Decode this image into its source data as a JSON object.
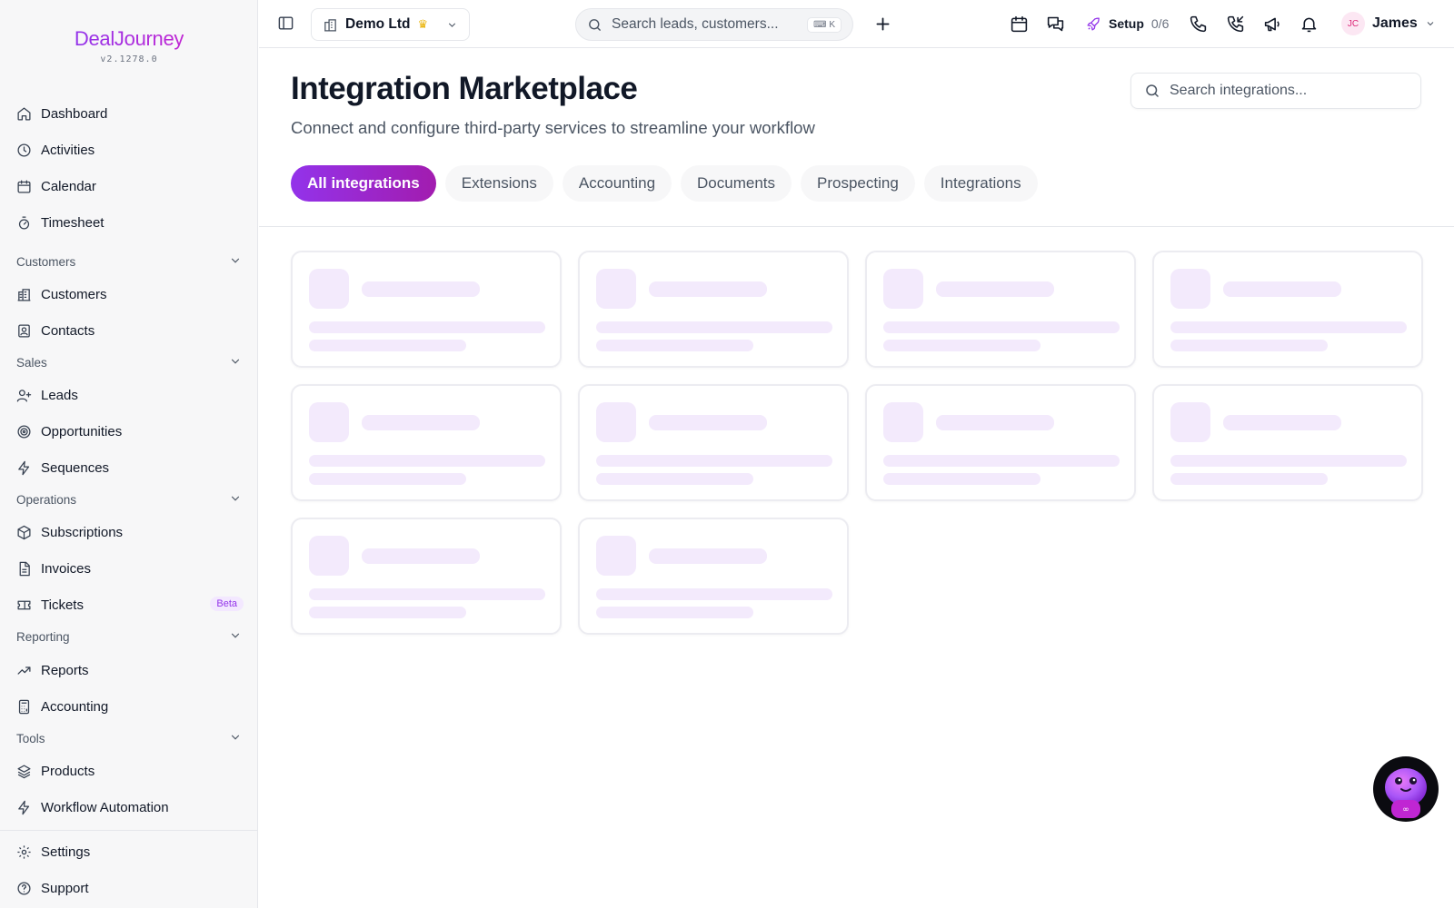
{
  "app": {
    "logo": "DealJourney",
    "version": "v2.1278.0"
  },
  "sidebar": {
    "items_top": [
      {
        "label": "Dashboard",
        "icon": "home-icon"
      },
      {
        "label": "Activities",
        "icon": "clock-icon"
      },
      {
        "label": "Calendar",
        "icon": "calendar-icon"
      },
      {
        "label": "Timesheet",
        "icon": "timer-icon"
      }
    ],
    "sections": [
      {
        "title": "Customers",
        "items": [
          {
            "label": "Customers",
            "icon": "building-icon"
          },
          {
            "label": "Contacts",
            "icon": "contact-icon"
          }
        ]
      },
      {
        "title": "Sales",
        "items": [
          {
            "label": "Leads",
            "icon": "user-plus-icon"
          },
          {
            "label": "Opportunities",
            "icon": "target-icon"
          },
          {
            "label": "Sequences",
            "icon": "zap-icon"
          }
        ]
      },
      {
        "title": "Operations",
        "items": [
          {
            "label": "Subscriptions",
            "icon": "box-icon"
          },
          {
            "label": "Invoices",
            "icon": "file-icon"
          },
          {
            "label": "Tickets",
            "icon": "ticket-icon",
            "badge": "Beta"
          }
        ]
      },
      {
        "title": "Reporting",
        "items": [
          {
            "label": "Reports",
            "icon": "trending-up-icon"
          },
          {
            "label": "Accounting",
            "icon": "calculator-icon"
          }
        ]
      },
      {
        "title": "Tools",
        "items": [
          {
            "label": "Products",
            "icon": "layers-icon"
          },
          {
            "label": "Workflow Automation",
            "icon": "zap-icon"
          }
        ]
      }
    ],
    "footer": [
      {
        "label": "Settings",
        "icon": "gear-icon"
      },
      {
        "label": "Support",
        "icon": "help-circle-icon"
      }
    ]
  },
  "topbar": {
    "org_name": "Demo Ltd",
    "search_placeholder": "Search leads, customers...",
    "search_shortcut": "K",
    "setup_label": "Setup",
    "setup_progress": "0/6",
    "user_initials": "JC",
    "user_name": "James"
  },
  "main": {
    "title": "Integration Marketplace",
    "subtitle": "Connect and configure third-party services to streamline your workflow",
    "search_placeholder": "Search integrations...",
    "tabs": [
      {
        "label": "All integrations",
        "active": true
      },
      {
        "label": "Extensions",
        "active": false
      },
      {
        "label": "Accounting",
        "active": false
      },
      {
        "label": "Documents",
        "active": false
      },
      {
        "label": "Prospecting",
        "active": false
      },
      {
        "label": "Integrations",
        "active": false
      }
    ],
    "skeleton_card_count": 10
  },
  "colors": {
    "accent": "#9333ea",
    "accent_end": "#a21caf",
    "skeleton": "#f3eafc",
    "badge_bg": "#f3e8ff"
  }
}
